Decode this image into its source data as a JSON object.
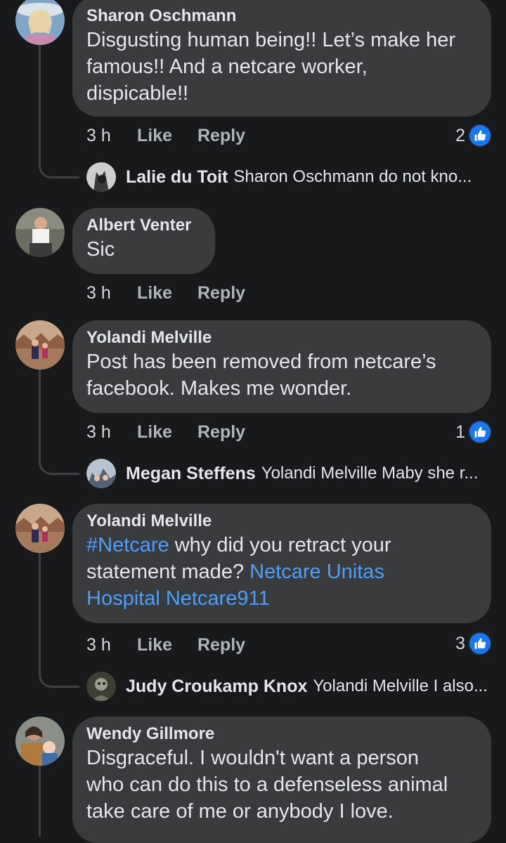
{
  "comments": [
    {
      "author": "Sharon Oschmann",
      "lines": [
        "Disgusting human being!!  Let’s make her",
        "famous!! And a netcare worker,",
        "dispicable!!"
      ],
      "time": "3 h",
      "like": "Like",
      "reply": "Reply",
      "reactions": "2",
      "reply_preview": {
        "author": "Lalie du Toit",
        "text": "Sharon Oschmann do not kno..."
      }
    },
    {
      "author": "Albert Venter",
      "lines": [
        "Sic"
      ],
      "time": "3 h",
      "like": "Like",
      "reply": "Reply"
    },
    {
      "author": "Yolandi Melville",
      "lines": [
        "Post has been removed from netcare’s",
        "facebook. Makes me wonder."
      ],
      "time": "3 h",
      "like": "Like",
      "reply": "Reply",
      "reactions": "1",
      "reply_preview": {
        "author": "Megan Steffens",
        "text": "Yolandi Melville Maby she r..."
      }
    },
    {
      "author": "Yolandi Melville",
      "hashtag": "#Netcare",
      "line1_rest": " why did you retract your",
      "line2_text": "statement made? ",
      "link1": "Netcare Unitas",
      "link2": "Hospital Netcare911",
      "time": "3 h",
      "like": "Like",
      "reply": "Reply",
      "reactions": "3",
      "reply_preview": {
        "author": "Judy Croukamp Knox",
        "text": "Yolandi Melville I also..."
      }
    },
    {
      "author": "Wendy Gillmore",
      "lines": [
        "Disgraceful. I wouldn't want a person",
        "who can do this to a defenseless animal",
        "take care of me or anybody I love."
      ]
    }
  ],
  "icons": {
    "reaction": "thumbs-up-icon"
  },
  "colors": {
    "background": "#18191a",
    "bubble": "#3a3b3c",
    "link": "#4a9eff",
    "like_badge": "#1877f2"
  }
}
